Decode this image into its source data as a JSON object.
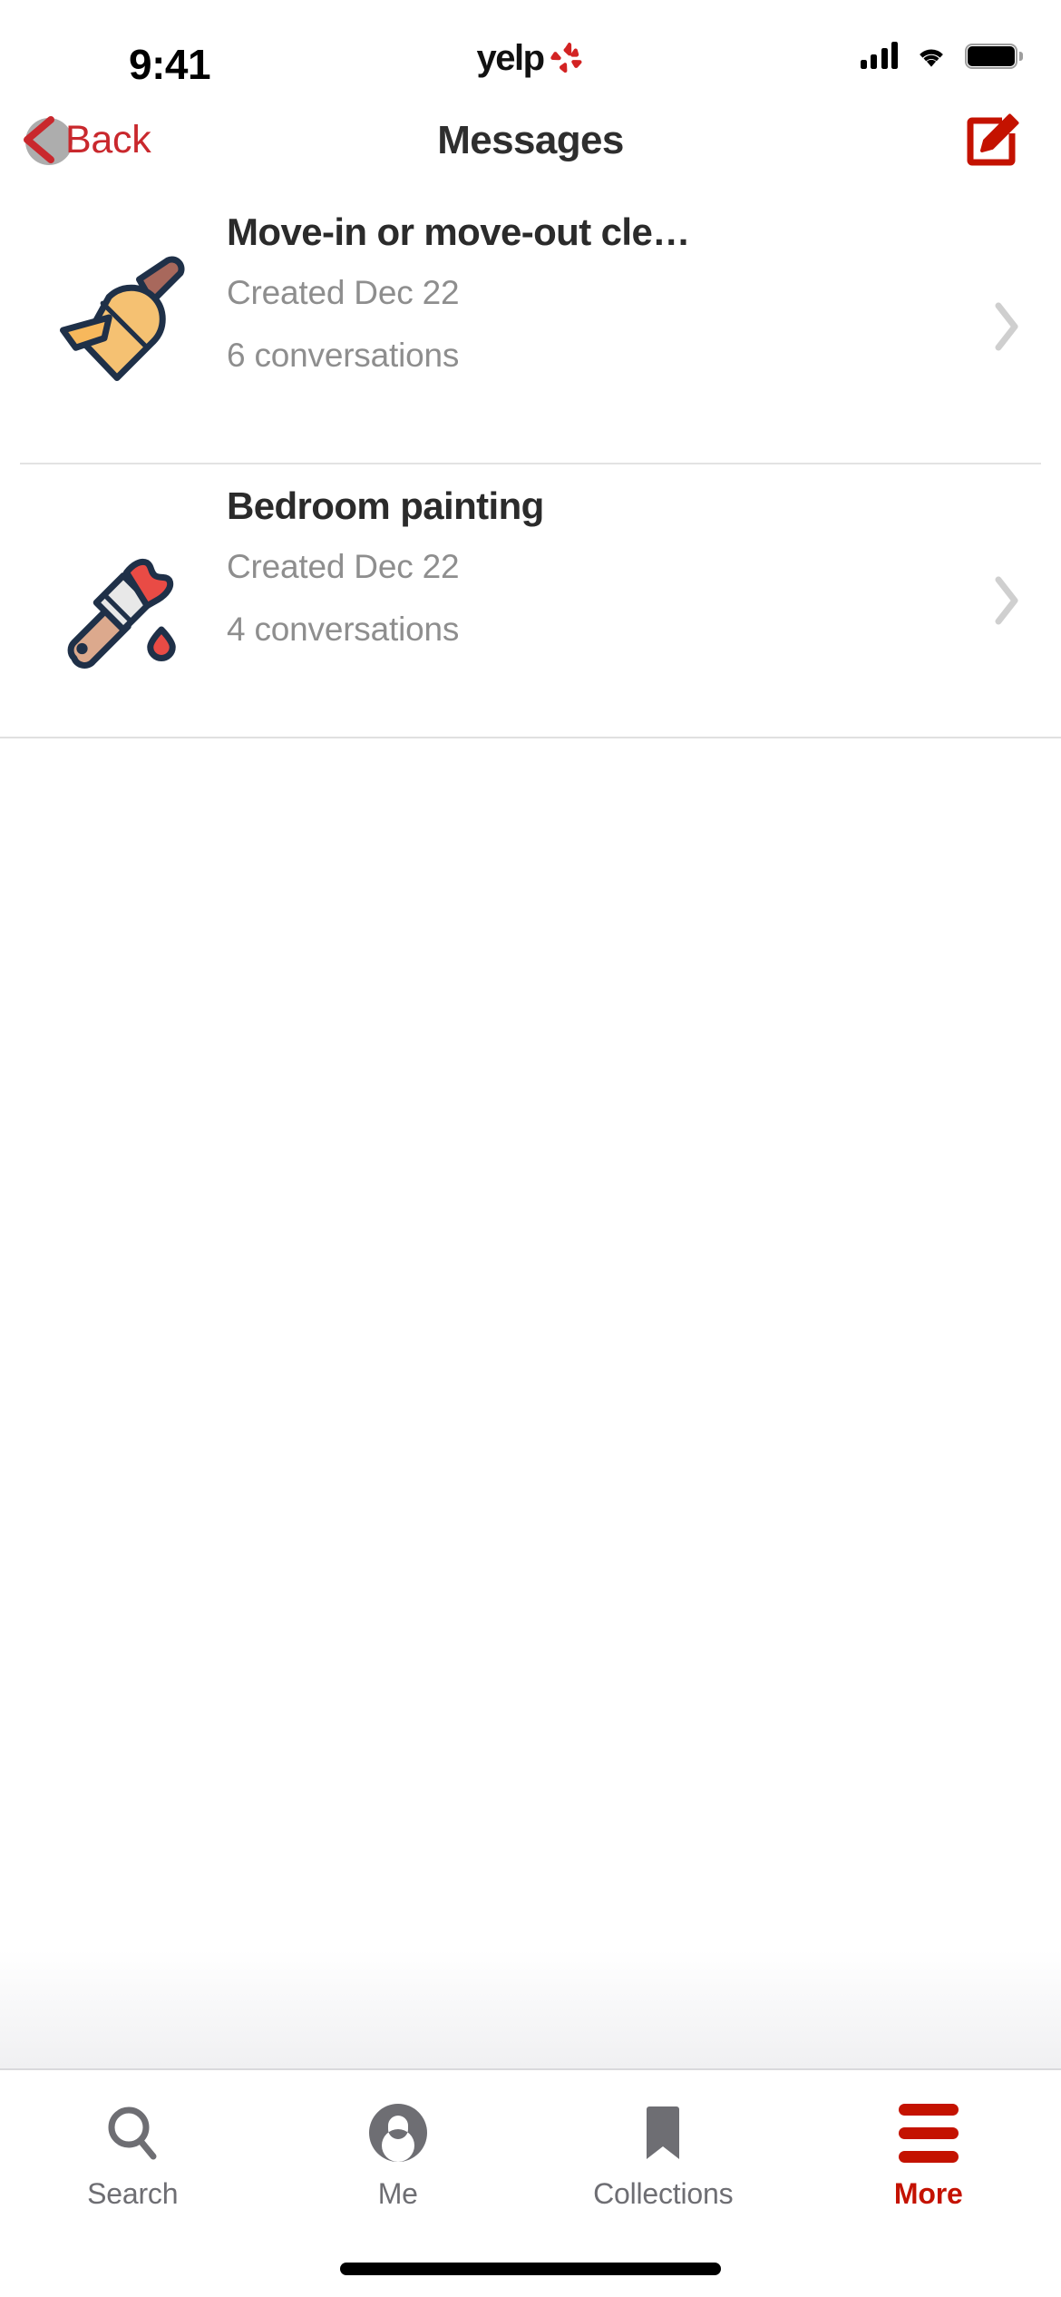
{
  "status_bar": {
    "time": "9:41",
    "brand": "yelp",
    "brand_icon": "yelp-burst-icon",
    "signal_icon": "cellular-signal-icon",
    "wifi_icon": "wifi-icon",
    "battery_icon": "battery-full-icon"
  },
  "nav_bar": {
    "back_label": "Back",
    "back_icon": "chevron-left-icon",
    "title": "Messages",
    "compose_icon": "compose-icon"
  },
  "messages": [
    {
      "icon": "broom-icon",
      "title": "Move-in or move-out cle…",
      "created": "Created Dec 22",
      "conversations": "6 conversations",
      "chevron": "chevron-right-icon"
    },
    {
      "icon": "paintbrush-icon",
      "title": "Bedroom painting",
      "created": "Created Dec 22",
      "conversations": "4 conversations",
      "chevron": "chevron-right-icon"
    }
  ],
  "tab_bar": [
    {
      "label": "Search",
      "icon": "search-icon",
      "active": false
    },
    {
      "label": "Me",
      "icon": "person-circle-icon",
      "active": false
    },
    {
      "label": "Collections",
      "icon": "bookmark-icon",
      "active": false
    },
    {
      "label": "More",
      "icon": "hamburger-menu-icon",
      "active": true
    }
  ],
  "colors": {
    "yelp_red": "#c41200",
    "back_red": "#c9282d",
    "text_primary": "#2b2b2b",
    "text_secondary": "#8e8e8e",
    "divider": "#e3e3e3",
    "tab_inactive": "#6e6e73"
  }
}
